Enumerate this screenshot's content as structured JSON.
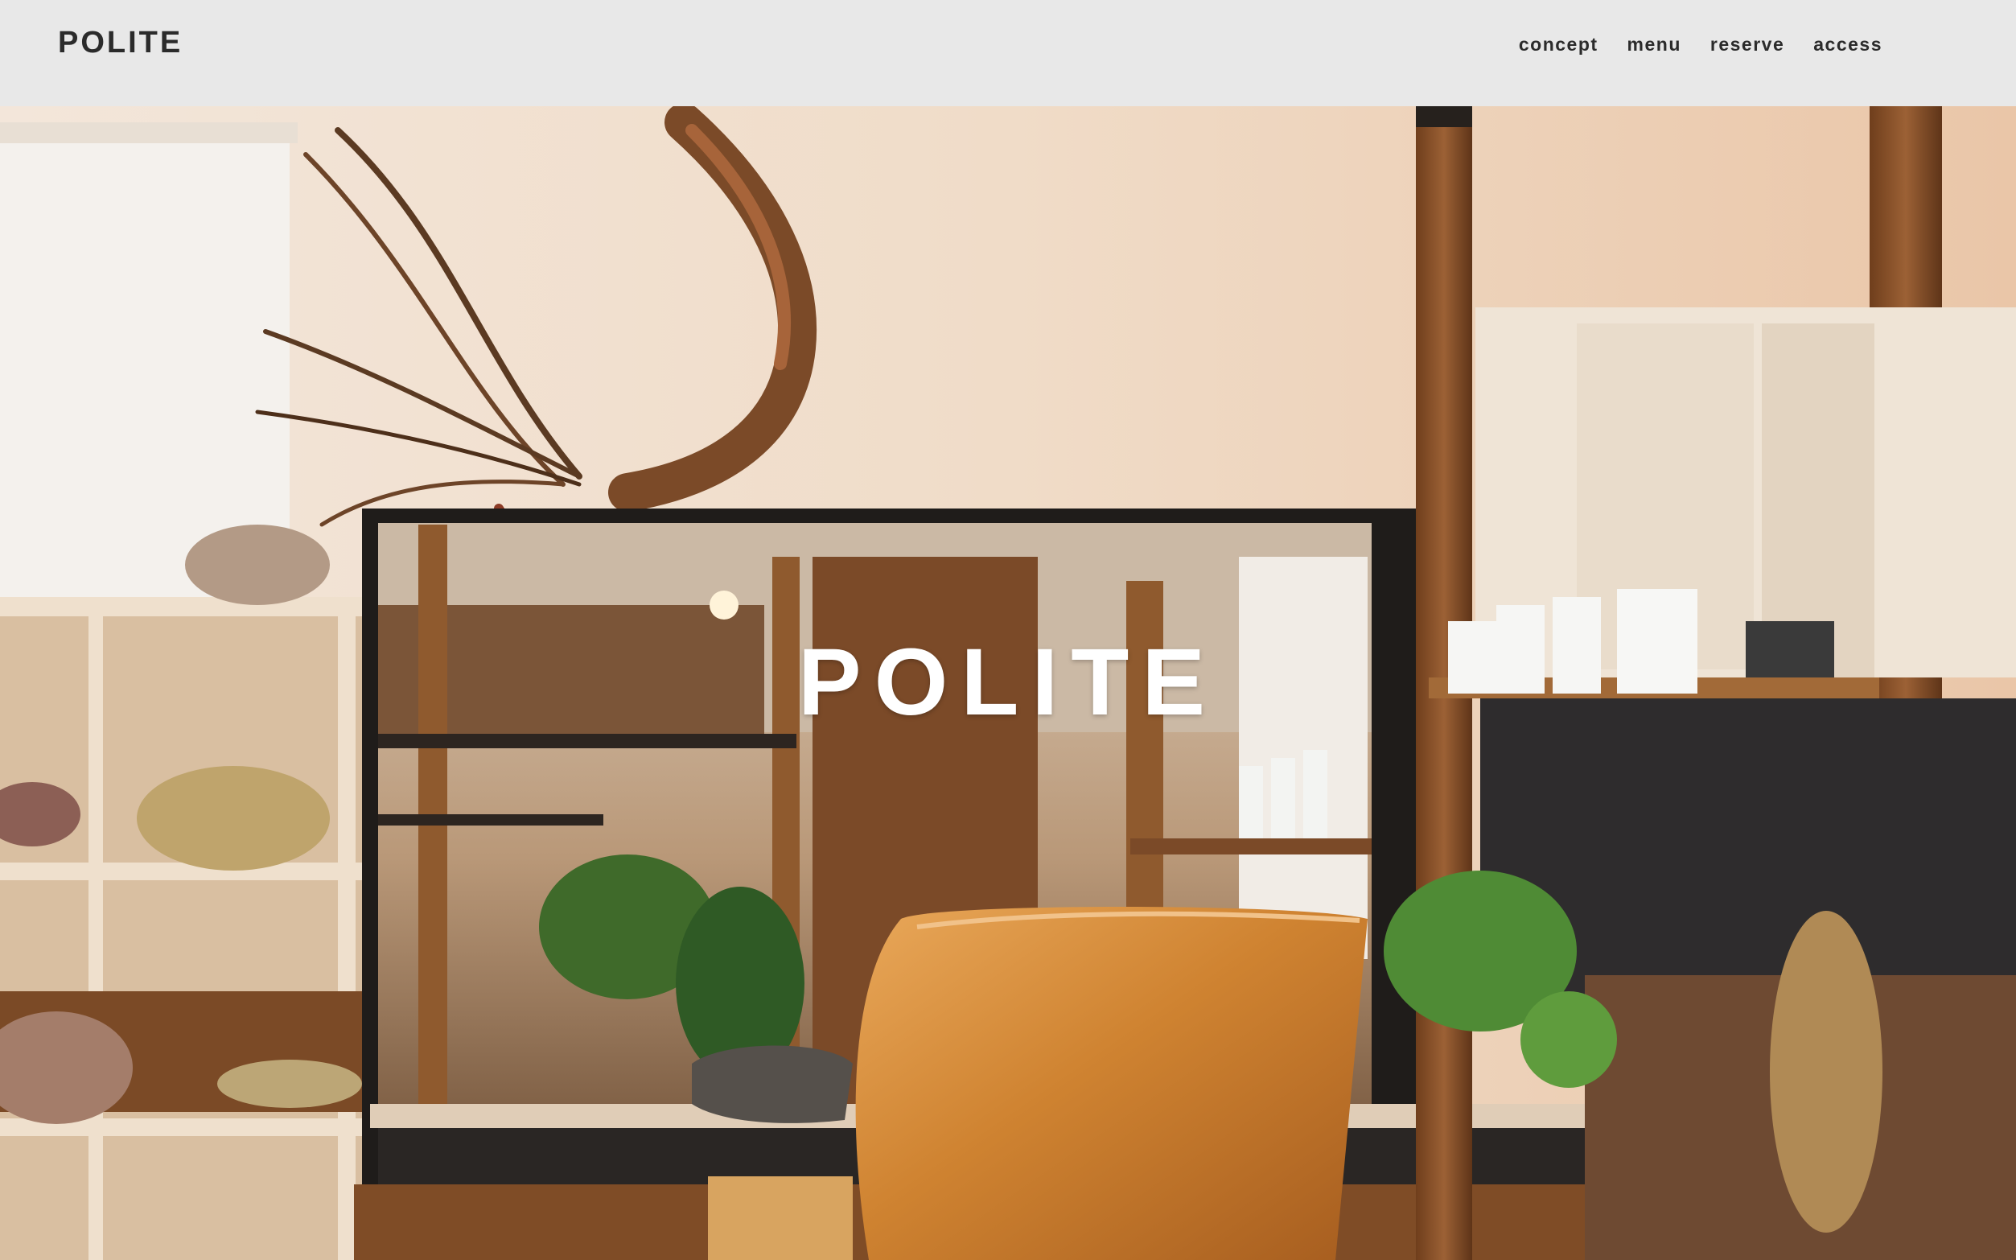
{
  "header": {
    "logo": "POLITE",
    "nav": [
      {
        "label": "concept"
      },
      {
        "label": "menu"
      },
      {
        "label": "reserve"
      },
      {
        "label": "access"
      }
    ]
  },
  "hero": {
    "title": "POLITE",
    "image_alt_icon": "salon-interior-photo"
  },
  "colors": {
    "header_bg": "#e8e8e8",
    "text_dark": "#2b2b2b",
    "hero_title": "#ffffff"
  }
}
